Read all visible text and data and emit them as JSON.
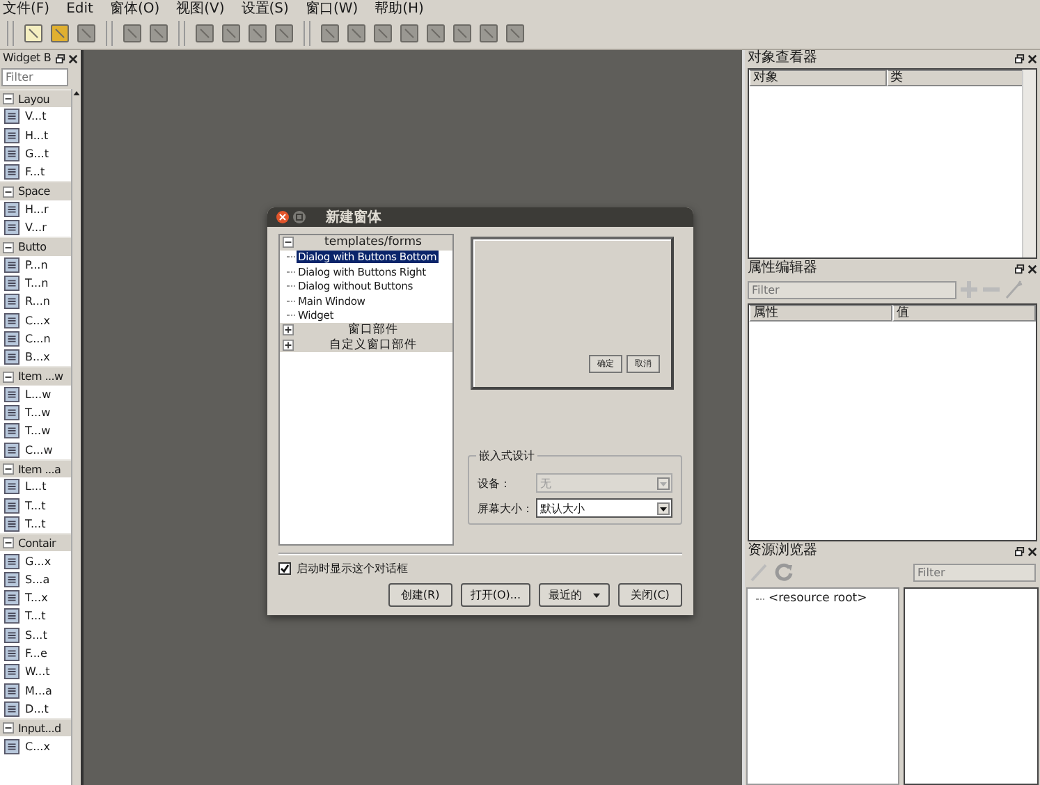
{
  "menu_bar": [
    "文件(F)",
    "Edit",
    "窗体(O)",
    "视图(V)",
    "设置(S)",
    "窗口(W)",
    "帮助(H)"
  ],
  "widget_box": {
    "title": "Widget B",
    "filter": {
      "placeholder": "Filter"
    },
    "categories": [
      {
        "label": "Layou",
        "expanded": true,
        "items": [
          "V...t",
          "H...t",
          "G...t",
          "F...t"
        ]
      },
      {
        "label": "Space",
        "expanded": true,
        "items": [
          "H...r",
          "V...r"
        ]
      },
      {
        "label": "Butto",
        "expanded": true,
        "items": [
          "P...n",
          "T...n",
          "R...n",
          "C...x",
          "C...n",
          "B...x"
        ]
      },
      {
        "label": "Item ...w",
        "expanded": true,
        "items": [
          "L...w",
          "T...w",
          "T...w",
          "C...w"
        ]
      },
      {
        "label": "Item ...a",
        "expanded": true,
        "items": [
          "L...t",
          "T...t",
          "T...t"
        ]
      },
      {
        "label": "Contair",
        "expanded": true,
        "items": [
          "G...x",
          "S...a",
          "T...x",
          "T...t",
          "S...t",
          "F...e",
          "W...t",
          "M...a",
          "D...t"
        ]
      },
      {
        "label": "Input...d",
        "expanded": true,
        "items": [
          "C...x"
        ]
      }
    ]
  },
  "dialog": {
    "title": "新建窗体",
    "tree": [
      {
        "label": "templates/forms",
        "expanded": true,
        "children": [
          {
            "label": "Dialog with Buttons Bottom",
            "selected": true
          },
          {
            "label": "Dialog with Buttons Right",
            "selected": false
          },
          {
            "label": "Dialog without Buttons",
            "selected": false
          },
          {
            "label": "Main Window",
            "selected": false
          },
          {
            "label": "Widget",
            "selected": false
          }
        ]
      },
      {
        "label": "窗口部件",
        "expanded": false
      },
      {
        "label": "自定义窗口部件",
        "expanded": false
      }
    ],
    "preview_buttons": [
      "确定",
      "取消"
    ],
    "embedded": {
      "title": "嵌入式设计",
      "device": {
        "label": "设备：",
        "value": "无",
        "disabled": true
      },
      "screen_size": {
        "label": "屏幕大小：",
        "value": "默认大小",
        "disabled": false
      }
    },
    "show_on_startup": {
      "label": "启动时显示这个对话框",
      "checked": true
    },
    "buttons": [
      {
        "label": "创建(R)",
        "kind": "push"
      },
      {
        "label": "打开(O)...",
        "kind": "push"
      },
      {
        "label": "最近的",
        "kind": "menu"
      },
      {
        "label": "关闭(C)",
        "kind": "push"
      }
    ]
  },
  "object_inspector": {
    "title": "对象查看器",
    "columns": [
      "对象",
      "类"
    ]
  },
  "property_editor": {
    "title": "属性编辑器",
    "filter": {
      "placeholder": "Filter"
    },
    "columns": [
      "属性",
      "值"
    ]
  },
  "resource_browser": {
    "title": "资源浏览器",
    "filter": {
      "placeholder": "Filter"
    },
    "tree": [
      "<resource root>"
    ]
  }
}
